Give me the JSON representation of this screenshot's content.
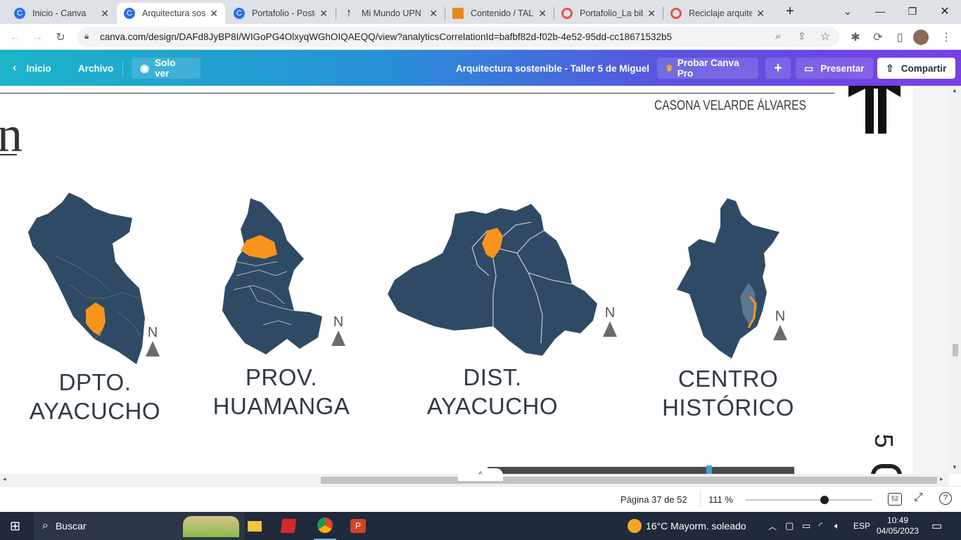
{
  "browser": {
    "tabs": [
      {
        "title": "Inicio - Canva",
        "icon": "canva-icon",
        "color": "#2b6fe6"
      },
      {
        "title": "Arquitectura sosteni",
        "icon": "canva-icon",
        "color": "#2b6fe6"
      },
      {
        "title": "Portafolio - Poste",
        "icon": "canva-icon",
        "color": "#2b6fe6"
      },
      {
        "title": "Mi Mundo UPN",
        "icon": "upn-icon",
        "color": "#222222"
      },
      {
        "title": "Contenido / TALL",
        "icon": "pencil-icon",
        "color": "#e68a1a"
      },
      {
        "title": "Portafolio_La bibl",
        "icon": "issuu-icon",
        "color": "#e2574c"
      },
      {
        "title": "Reciclaje arquitec",
        "icon": "issuu-icon",
        "color": "#e2574c"
      }
    ],
    "url": "canva.com/design/DAFd8JyBP8I/WIGoPG4OlxyqWGhOIQAEQQ/view?analyticsCorrelationId=bafbf82d-f02b-4e52-95dd-cc18671532b5"
  },
  "canva": {
    "back_label": "Inicio",
    "file_label": "Archivo",
    "view_label": "Solo ver",
    "doc_title": "Arquitectura sostenible - Taller 5 de Miguel",
    "pro_label": "Probar Canva Pro",
    "add_label": "+",
    "present_label": "Presentar",
    "share_label": "Compartir"
  },
  "slide": {
    "header_text": "CASONA VELARDE ÁLVARES",
    "partial_letter": "n",
    "side_text": "5",
    "north_label": "N",
    "maps": [
      {
        "line1": "DPTO.",
        "line2": "AYACUCHO"
      },
      {
        "line1": "PROV.",
        "line2": "HUAMANGA"
      },
      {
        "line1": "DIST.",
        "line2": "AYACUCHO"
      },
      {
        "line1": "CENTRO",
        "line2": "HISTÓRICO"
      }
    ],
    "map_color": "#2f4a64",
    "highlight_color": "#f7941d"
  },
  "footer": {
    "page_label": "Página 37 de 52",
    "zoom_label": "111 %",
    "zoom_fraction": 0.62,
    "grid_count": "52"
  },
  "taskbar": {
    "search_placeholder": "Buscar",
    "weather": "16°C  Mayorm. soleado",
    "lang": "ESP",
    "time": "10:49",
    "date": "04/05/2023"
  }
}
